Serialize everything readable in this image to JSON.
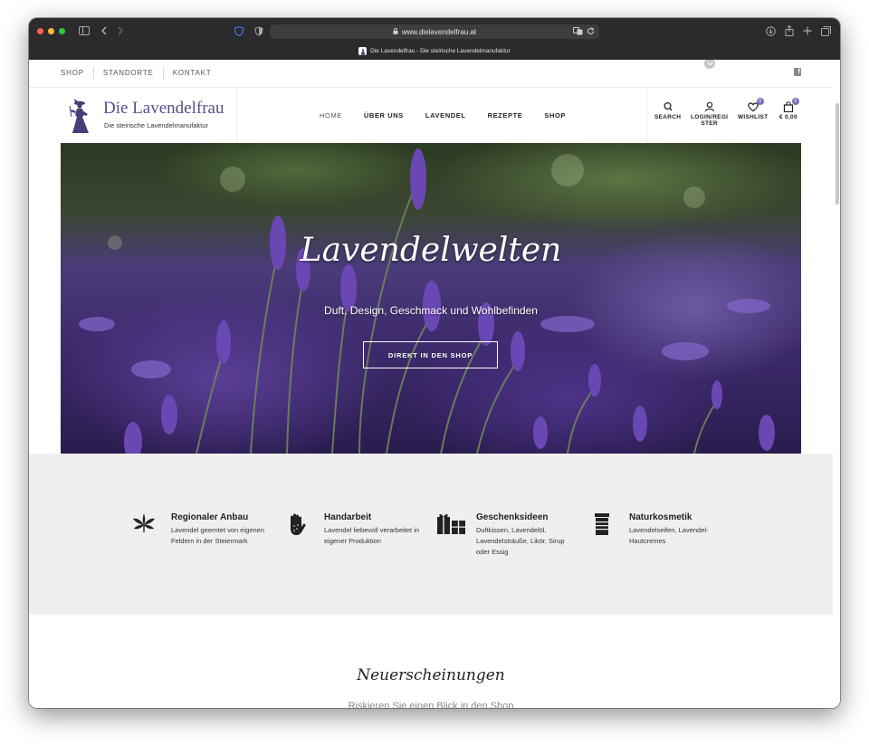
{
  "browser": {
    "url": "www.dielavendelfrau.at",
    "tab_title": "Die Lavendelfrau - Die steirische Lavendelmanufaktur"
  },
  "topbar": {
    "links": [
      "SHOP",
      "STANDORTE",
      "KONTAKT"
    ]
  },
  "logo": {
    "title": "Die Lavendelfrau",
    "subtitle": "Die steirische Lavendelmanufaktur"
  },
  "nav": {
    "items": [
      "HOME",
      "ÜBER UNS",
      "LAVENDEL",
      "REZEPTE",
      "SHOP"
    ],
    "active": "HOME"
  },
  "header_icons": {
    "search": "SEARCH",
    "login_line1": "LOGIN/REGI",
    "login_line2": "STER",
    "wishlist": "WISHLIST",
    "wishlist_count": "0",
    "cart_total": "€ 0,00",
    "cart_count": "0"
  },
  "hero": {
    "title": "Lavendelwelten",
    "subtitle": "Duft, Design, Geschmack und Wohlbefinden",
    "button": "DIREKT IN DEN SHOP"
  },
  "features": [
    {
      "icon": "leaf-icon",
      "title": "Regionaler Anbau",
      "text": "Lavendel geerntet von eigenen Feldern in der Steiermark"
    },
    {
      "icon": "hand-icon",
      "title": "Handarbeit",
      "text": "Lavendel liebevoll verarbeitet in eigener Produktion"
    },
    {
      "icon": "gift-icon",
      "title": "Geschenksideen",
      "text": "Duftkissen, Lavendelöl, Lavendelsträuße, Likör, Sirup oder Essig"
    },
    {
      "icon": "cosmetics-icon",
      "title": "Naturkosmetik",
      "text": "Lavendelseifen, Lavendel-Hautcremes"
    }
  ],
  "new_section": {
    "title": "Neuerscheinungen",
    "subtitle": "Riskieren Sie einen Blick in den Shop"
  },
  "colors": {
    "brand_purple": "#5d4b8a",
    "badge": "#7c6cc2",
    "feature_bg": "#efefef"
  }
}
